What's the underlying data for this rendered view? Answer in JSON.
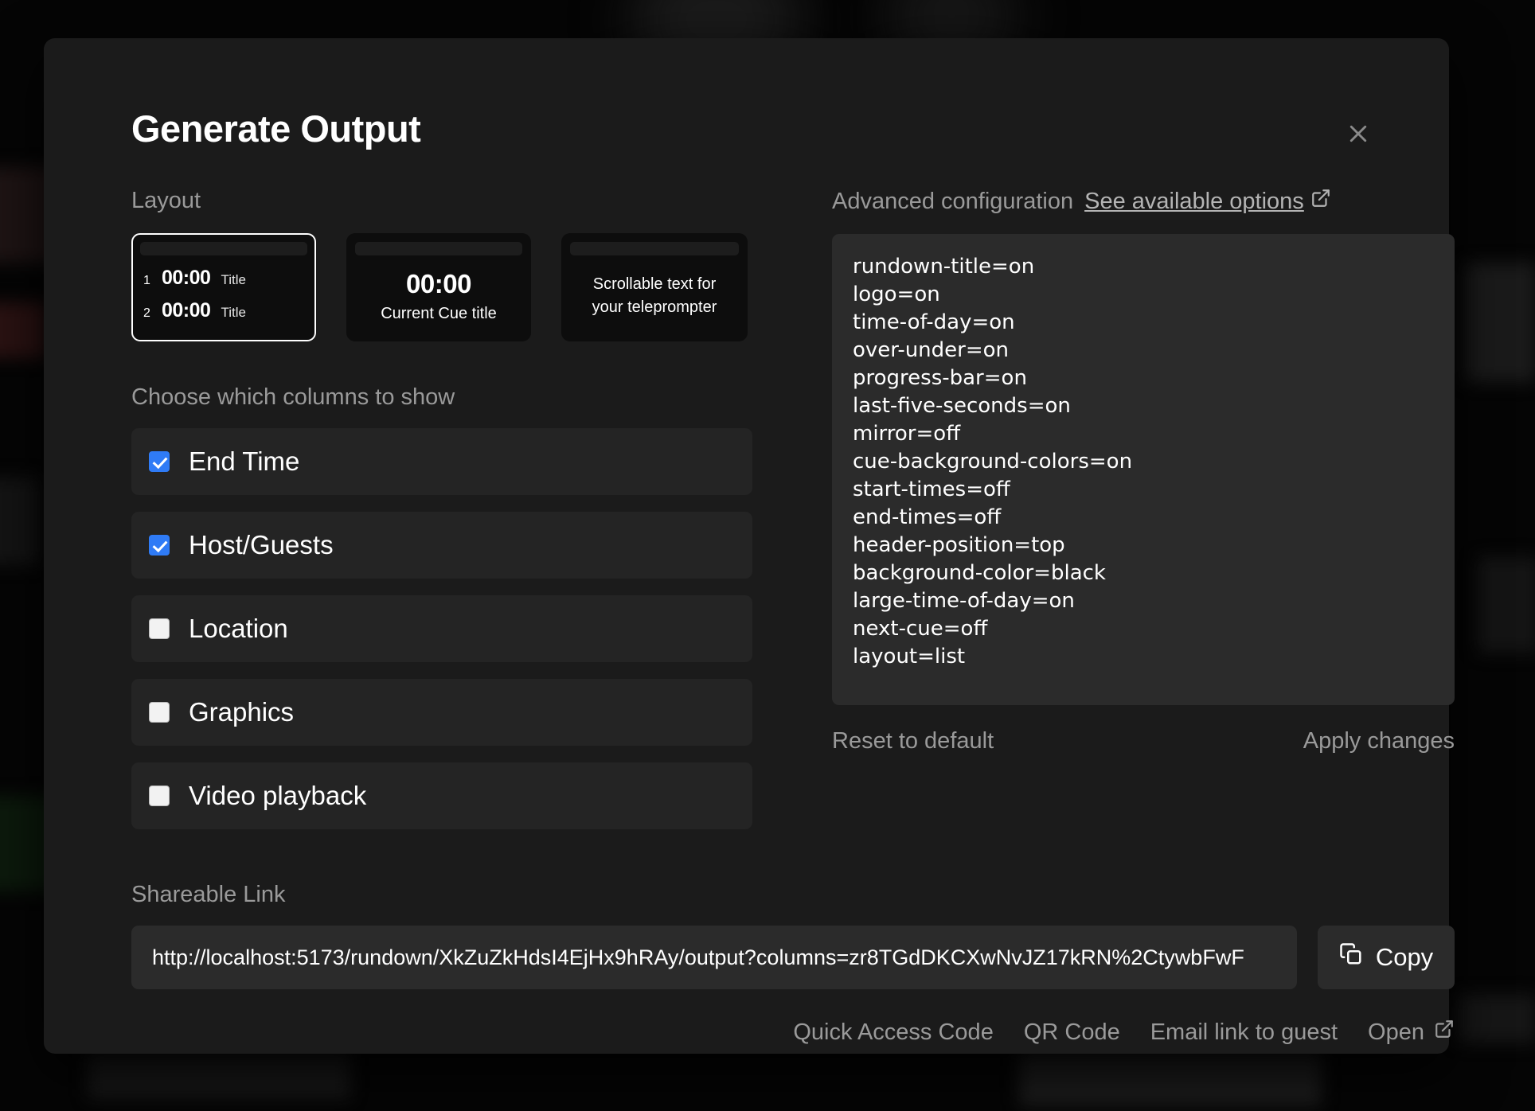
{
  "modal": {
    "title": "Generate Output",
    "close_icon": "close-icon"
  },
  "layout": {
    "label": "Layout",
    "cards": [
      {
        "id": "list",
        "selected": true,
        "rows": [
          {
            "index": "1",
            "time": "00:00",
            "title": "Title"
          },
          {
            "index": "2",
            "time": "00:00",
            "title": "Title"
          }
        ]
      },
      {
        "id": "single",
        "selected": false,
        "time": "00:00",
        "subtitle": "Current Cue title"
      },
      {
        "id": "teleprompter",
        "selected": false,
        "line1": "Scrollable text for",
        "line2": "your teleprompter"
      }
    ]
  },
  "columns": {
    "label": "Choose which columns to show",
    "items": [
      {
        "label": "End Time",
        "checked": true
      },
      {
        "label": "Host/Guests",
        "checked": true
      },
      {
        "label": "Location",
        "checked": false
      },
      {
        "label": "Graphics",
        "checked": false
      },
      {
        "label": "Video playback",
        "checked": false
      }
    ]
  },
  "advanced": {
    "label": "Advanced configuration",
    "link_label": "See available options",
    "link_icon": "external-link-icon",
    "config_lines": [
      "rundown-title=on",
      "logo=on",
      "time-of-day=on",
      "over-under=on",
      "progress-bar=on",
      "last-five-seconds=on",
      "mirror=off",
      "cue-background-colors=on",
      "start-times=off",
      "end-times=off",
      "header-position=top",
      "background-color=black",
      "large-time-of-day=on",
      "next-cue=off",
      "layout=list"
    ],
    "config_text": "rundown-title=on\nlogo=on\ntime-of-day=on\nover-under=on\nprogress-bar=on\nlast-five-seconds=on\nmirror=off\ncue-background-colors=on\nstart-times=off\nend-times=off\nheader-position=top\nbackground-color=black\nlarge-time-of-day=on\nnext-cue=off\nlayout=list",
    "reset_label": "Reset to default",
    "apply_label": "Apply changes"
  },
  "share": {
    "label": "Shareable Link",
    "url": "http://localhost:5173/rundown/XkZuZkHdsI4EjHx9hRAy/output?columns=zr8TGdDKCXwNvJZ17kRN%2CtywbFwF",
    "copy_label": "Copy",
    "copy_icon": "copy-icon",
    "links": [
      {
        "label": "Quick Access Code",
        "icon": null
      },
      {
        "label": "QR Code",
        "icon": null
      },
      {
        "label": "Email link to guest",
        "icon": null
      },
      {
        "label": "Open",
        "icon": "external-link-icon"
      }
    ]
  },
  "colors": {
    "accent": "#2f7bf6",
    "modal_bg": "#1b1b1b",
    "field_bg": "#2b2b2b",
    "row_bg": "#242424",
    "muted_text": "#9a9a9a"
  }
}
